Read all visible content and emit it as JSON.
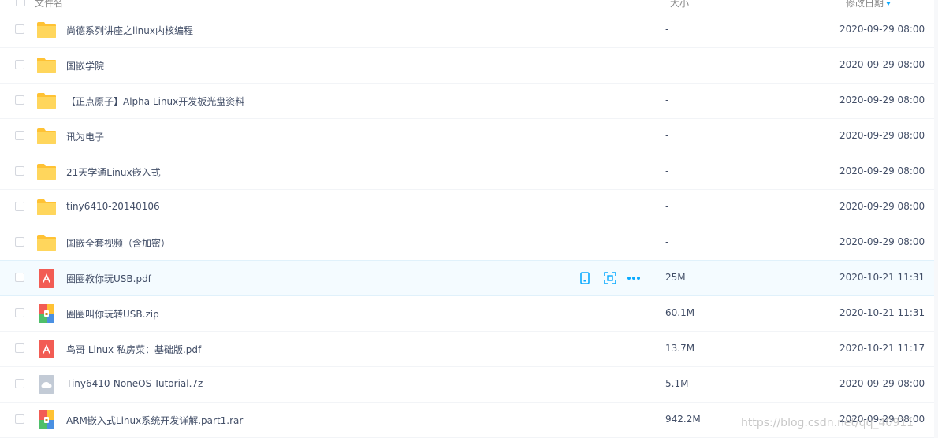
{
  "header": {
    "name_label": "文件名",
    "size_label": "大小",
    "date_label": "修改日期"
  },
  "rows": [
    {
      "name": "尚德系列讲座之linux内核编程",
      "size": "-",
      "date": "2020-09-29 08:00",
      "type": "folder"
    },
    {
      "name": "国嵌学院",
      "size": "-",
      "date": "2020-09-29 08:00",
      "type": "folder"
    },
    {
      "name": "【正点原子】Alpha Linux开发板光盘资料",
      "size": "-",
      "date": "2020-09-29 08:00",
      "type": "folder"
    },
    {
      "name": "讯为电子",
      "size": "-",
      "date": "2020-09-29 08:00",
      "type": "folder"
    },
    {
      "name": "21天学通Linux嵌入式",
      "size": "-",
      "date": "2020-09-29 08:00",
      "type": "folder"
    },
    {
      "name": "tiny6410-20140106",
      "size": "-",
      "date": "2020-09-29 08:00",
      "type": "folder"
    },
    {
      "name": "国嵌全套视频（含加密）",
      "size": "-",
      "date": "2020-09-29 08:00",
      "type": "folder"
    },
    {
      "name": "圈圈教你玩USB.pdf",
      "size": "25M",
      "date": "2020-10-21 11:31",
      "type": "pdf"
    },
    {
      "name": "圈圈叫你玩转USB.zip",
      "size": "60.1M",
      "date": "2020-10-21 11:31",
      "type": "zip"
    },
    {
      "name": "鸟哥 Linux 私房菜：基础版.pdf",
      "size": "13.7M",
      "date": "2020-10-21 11:17",
      "type": "pdf"
    },
    {
      "name": "Tiny6410-NoneOS-Tutorial.7z",
      "size": "5.1M",
      "date": "2020-09-29 08:00",
      "type": "7z"
    },
    {
      "name": "ARM嵌入式Linux系统开发详解.part1.rar",
      "size": "942.2M",
      "date": "2020-09-29 08:00",
      "type": "zip"
    }
  ],
  "hover_row_index": 7,
  "row_actions": [
    "phone-icon",
    "scan-icon",
    "more-icon"
  ],
  "watermark": "https://blog.csdn.net/qq_40911",
  "colors": {
    "folder": "#ffd157",
    "pdf": "#f25c54",
    "accent": "#09aaff",
    "hover_bg": "#f4fbff"
  }
}
